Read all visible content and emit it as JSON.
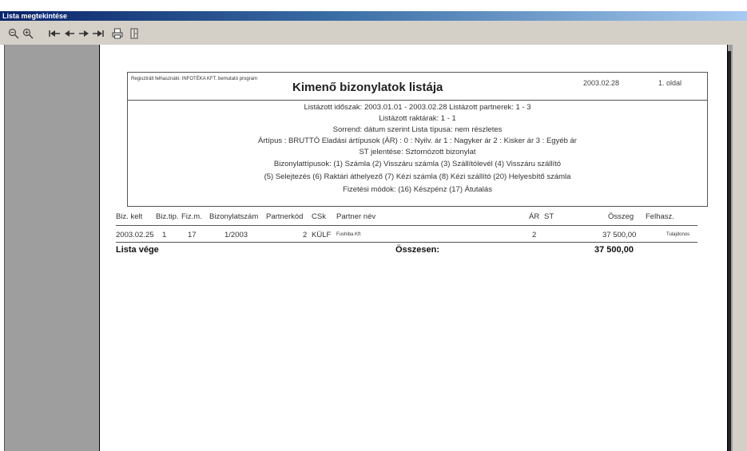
{
  "window": {
    "title": "Lista megtekintése"
  },
  "toolbar": {
    "buttons": [
      {
        "icon": "zoom-out-icon"
      },
      {
        "icon": "zoom-in-icon"
      },
      {
        "icon": "first-page-icon"
      },
      {
        "icon": "previous-page-icon"
      },
      {
        "icon": "next-page-icon"
      },
      {
        "icon": "last-page-icon"
      },
      {
        "icon": "print-icon"
      },
      {
        "icon": "exit-door-icon"
      }
    ]
  },
  "report": {
    "registered_user": "Regisztrált felhasználó: INFOTÉKA KFT. bemutató program",
    "title": "Kimenő bizonylatok listája",
    "date": "2003.02.28",
    "page": "1. oldal",
    "info_lines": [
      "Listázott időszak: 2003.01.01 - 2003.02.28  Listázott partnerek: 1 - 3",
      "Listázott raktárak: 1 - 1",
      "Sorrend: dátum szerint  Lista típusa: nem részletes",
      "Ártípus : BRUTTÓ  Eladási ártípusok (ÁR) :  0 : Nyilv. ár 1 : Nagyker ár 2 : Kisker ár 3 : Egyéb ár",
      "ST jelentése: Sztornózott bizonylat",
      "Bizonylattípusok: (1) Számla (2) Visszáru számla (3) Szállítólevél (4) Visszáru szállító",
      "(5) Selejtezés (6) Raktári áthelyező (7) Kézi számla (8) Kézi szállító (20) Helyesbítő számla",
      "Fizetési módok:  (16) Készpénz  (17) Átutalás"
    ],
    "columns": {
      "biz_kelt": "Biz. kelt",
      "biz_tip": "Biz.tip.",
      "fiz_m": "Fiz.m.",
      "bizonylatszam": "Bizonylatszám",
      "partnerkod": "Partnerkód",
      "csk": "CSk",
      "partner_nev": "Partner név",
      "ar": "ÁR",
      "st": "ST",
      "osszeg": "Összeg",
      "felhasz": "Felhasz."
    },
    "rows": [
      {
        "biz_kelt": "2003.02.25",
        "biz_tip": "1",
        "fiz_m": "17",
        "bizonylatszam": "1/2003",
        "partnerkod": "2",
        "csk": "KÜLF",
        "partner_nev": "Fushiba Kft",
        "ar": "2",
        "st": "",
        "osszeg": "37 500,00",
        "felhasz": "Tulajdonos"
      }
    ],
    "footer": {
      "end_label": "Lista vége",
      "total_label": "Összesen:",
      "total_value": "37 500,00"
    }
  }
}
